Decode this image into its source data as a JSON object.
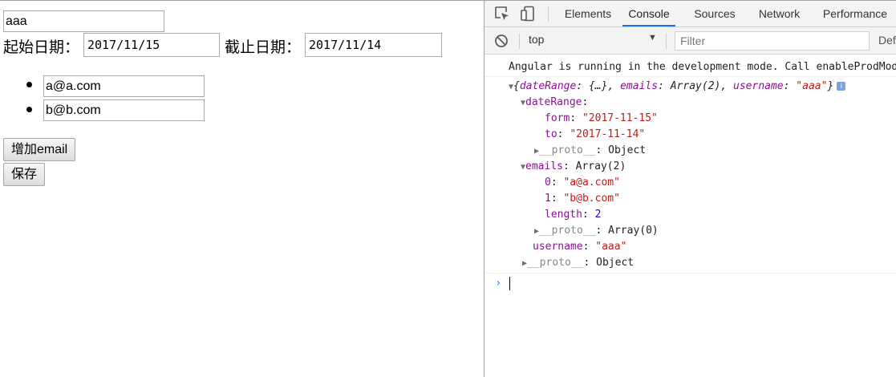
{
  "page": {
    "username": "aaa",
    "start_label": "起始日期：",
    "start_date": "2017/11/15",
    "end_label": "截止日期：",
    "end_date": "2017/11/14",
    "emails": [
      "a@a.com",
      "b@b.com"
    ],
    "add_email_button": "增加email",
    "save_button": "保存"
  },
  "devtools": {
    "tabs": [
      "Elements",
      "Console",
      "Sources",
      "Network",
      "Performance"
    ],
    "active_tab": "Console",
    "icons": [
      "inspect-element-icon",
      "device-toolbar-icon",
      "clear-console-icon",
      "dropdown-arrow-icon",
      "info-icon",
      "expand-triangle-icon",
      "collapse-triangle-icon",
      "prompt-chevron-icon"
    ],
    "context_value": "top",
    "context_arrow": "▼",
    "filter_placeholder": "Filter",
    "default_levels_label": "Def",
    "colors": {
      "accent": "#1a73e8",
      "key": "#881391",
      "string": "#c41a16",
      "number": "#1c00cf",
      "prompt": "#367cf1"
    }
  },
  "console": {
    "message": "Angular is running in the development mode. Call enableProdMode() to enable the production mode.",
    "summary": {
      "open": "{",
      "k1": "dateRange",
      "v1": "{…}",
      "k2": "emails",
      "v2": "Array(2)",
      "k3": "username",
      "v3": "\"aaa\"",
      "close": "}",
      "info": "i"
    },
    "dateRange_key": "dateRange",
    "form_key": "form",
    "form_value": "\"2017-11-15\"",
    "to_key": "to",
    "to_value": "\"2017-11-14\"",
    "proto_key": "__proto__",
    "proto_object": "Object",
    "emails_key": "emails",
    "emails_value": "Array(2)",
    "email0_key": "0",
    "email0_value": "\"a@a.com\"",
    "email1_key": "1",
    "email1_value": "\"b@b.com\"",
    "length_key": "length",
    "length_value": "2",
    "proto_array": "Array(0)",
    "username_key": "username",
    "username_value": "\"aaa\"",
    "colon": ": ",
    "tri_open": "▼",
    "tri_closed": "▶",
    "prompt": "›"
  }
}
